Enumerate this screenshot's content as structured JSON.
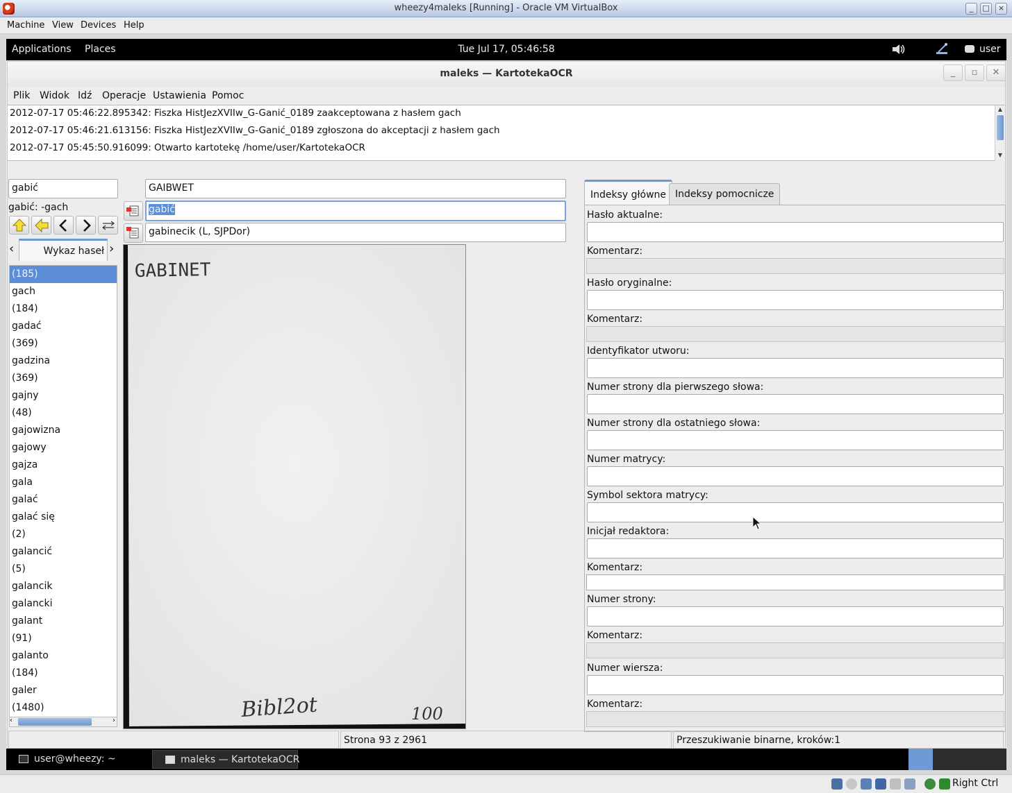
{
  "host": {
    "window_title": "wheezy4maleks [Running] - Oracle VM VirtualBox",
    "menu": [
      "Machine",
      "View",
      "Devices",
      "Help"
    ],
    "host_key": "Right Ctrl"
  },
  "panel": {
    "applications": "Applications",
    "places": "Places",
    "clock": "Tue Jul 17, 05:46:58",
    "user": "user"
  },
  "app": {
    "title": "maleks — KartotekaOCR",
    "menu": [
      "Plik",
      "Widok",
      "Idź",
      "Operacje",
      "Ustawienia",
      "Pomoc"
    ],
    "log": [
      "2012-07-17 05:46:22.895342: Fiszka HistJezXVIIw_G-Ganić_0189 zaakceptowana z hasłem gach",
      "2012-07-17 05:46:21.613156: Fiszka HistJezXVIIw_G-Ganić_0189 zgłoszona do akceptacji z hasłem gach",
      "2012-07-17 05:45:50.916099: Otwarto kartotekę /home/user/KartotekaOCR"
    ],
    "search_value": "gabić",
    "range_label": "gabić: -gach",
    "list_tab_label": "Wykaz haseł",
    "list_items": [
      "(185)",
      "gach",
      "(184)",
      "gadać",
      "(369)",
      "gadzina",
      "(369)",
      "gajny",
      "(48)",
      "gajowizna",
      "gajowy",
      "gajza",
      "gala",
      "galać",
      "galać się",
      "(2)",
      "galancić",
      "(5)",
      "galancik",
      "galancki",
      "galant",
      "(91)",
      "galanto",
      "(184)",
      "galer",
      "(1480)"
    ],
    "selected_index": 0,
    "ocr_field": "GAIBWET",
    "headword_field": "gabić",
    "hint_field": "gabinecik (L, SJPDor)",
    "card": {
      "heading": "GABINET",
      "signature": "Bibl2ot",
      "number": "100"
    },
    "tabs": {
      "main": "Indeksy główne",
      "aux": "Indeksy pomocnicze"
    },
    "fields": {
      "current_headword": "Hasło aktualne:",
      "comment": "Komentarz:",
      "original_headword": "Hasło oryginalne:",
      "work_id": "Identyfikator utworu:",
      "first_page": "Numer strony dla pierwszego słowa:",
      "last_page": "Numer strony dla ostatniego słowa:",
      "matrix_number": "Numer matrycy:",
      "matrix_sector": "Symbol sektora matrycy:",
      "editor_initial": "Inicjał redaktora:",
      "page_number": "Numer strony:",
      "line_number": "Numer wiersza:"
    },
    "status": {
      "left": "",
      "page": "Strona 93 z 2961",
      "search": "Przeszukiwanie binarne, kroków:1"
    }
  },
  "taskbar": {
    "terminal": "user@wheezy: ~",
    "app": "maleks — KartotekaOCR"
  }
}
